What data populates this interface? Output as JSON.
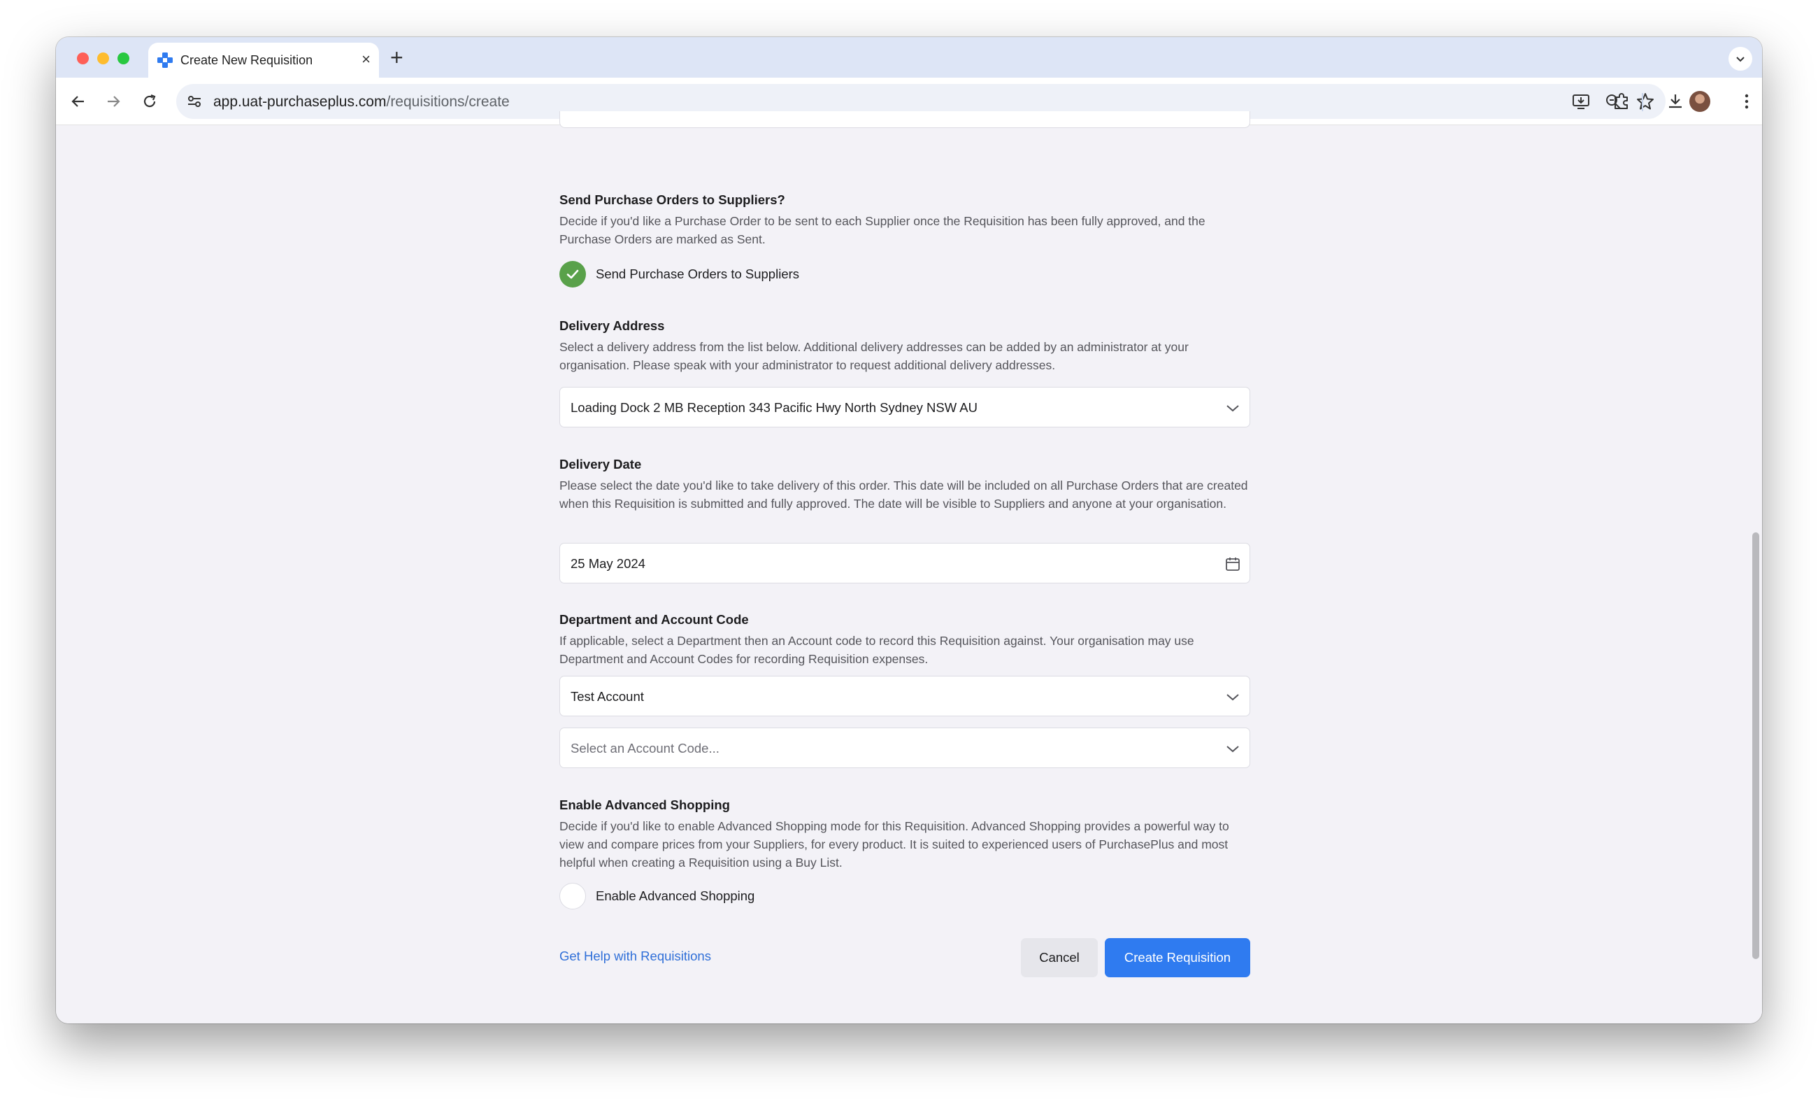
{
  "browser": {
    "tab_title": "Create New Requisition",
    "tab_close_glyph": "×",
    "new_tab_glyph": "+",
    "url_host": "app.uat-purchaseplus.com",
    "url_path": "/requisitions/create"
  },
  "sections": {
    "send_po": {
      "title": "Send Purchase Orders to Suppliers?",
      "description": "Decide if you'd like a Purchase Order to be sent to each Supplier once the Requisition has been fully approved, and the Purchase Orders are marked as Sent.",
      "checkbox_label": "Send Purchase Orders to Suppliers",
      "checked": true
    },
    "delivery_address": {
      "title": "Delivery Address",
      "description": "Select a delivery address from the list below. Additional delivery addresses can be added by an administrator at your organisation. Please speak with your administrator to request additional delivery addresses.",
      "selected": "Loading Dock 2 MB Reception 343 Pacific Hwy North Sydney NSW AU"
    },
    "delivery_date": {
      "title": "Delivery Date",
      "description": "Please select the date you'd like to take delivery of this order. This date will be included on all Purchase Orders that are created when this Requisition is submitted and fully approved. The date will be visible to Suppliers and anyone at your organisation.",
      "value": "25 May 2024"
    },
    "department": {
      "title": "Department and Account Code",
      "description": "If applicable, select a Department then an Account code to record this Requisition against. Your organisation may use Department and Account Codes for recording Requisition expenses.",
      "department_selected": "Test Account",
      "account_code_placeholder": "Select an Account Code..."
    },
    "advanced_shopping": {
      "title": "Enable Advanced Shopping",
      "description": "Decide if you'd like to enable Advanced Shopping mode for this Requisition. Advanced Shopping provides a powerful way to view and compare prices from your Suppliers, for every product. It is suited to experienced users of PurchasePlus and most helpful when creating a Requisition using a Buy List.",
      "checkbox_label": "Enable Advanced Shopping",
      "checked": false
    }
  },
  "footer": {
    "help_link": "Get Help with Requisitions",
    "cancel_label": "Cancel",
    "create_label": "Create Requisition"
  },
  "colors": {
    "primary": "#2f7bf0",
    "success": "#59a14a",
    "link": "#2f6fd8"
  }
}
